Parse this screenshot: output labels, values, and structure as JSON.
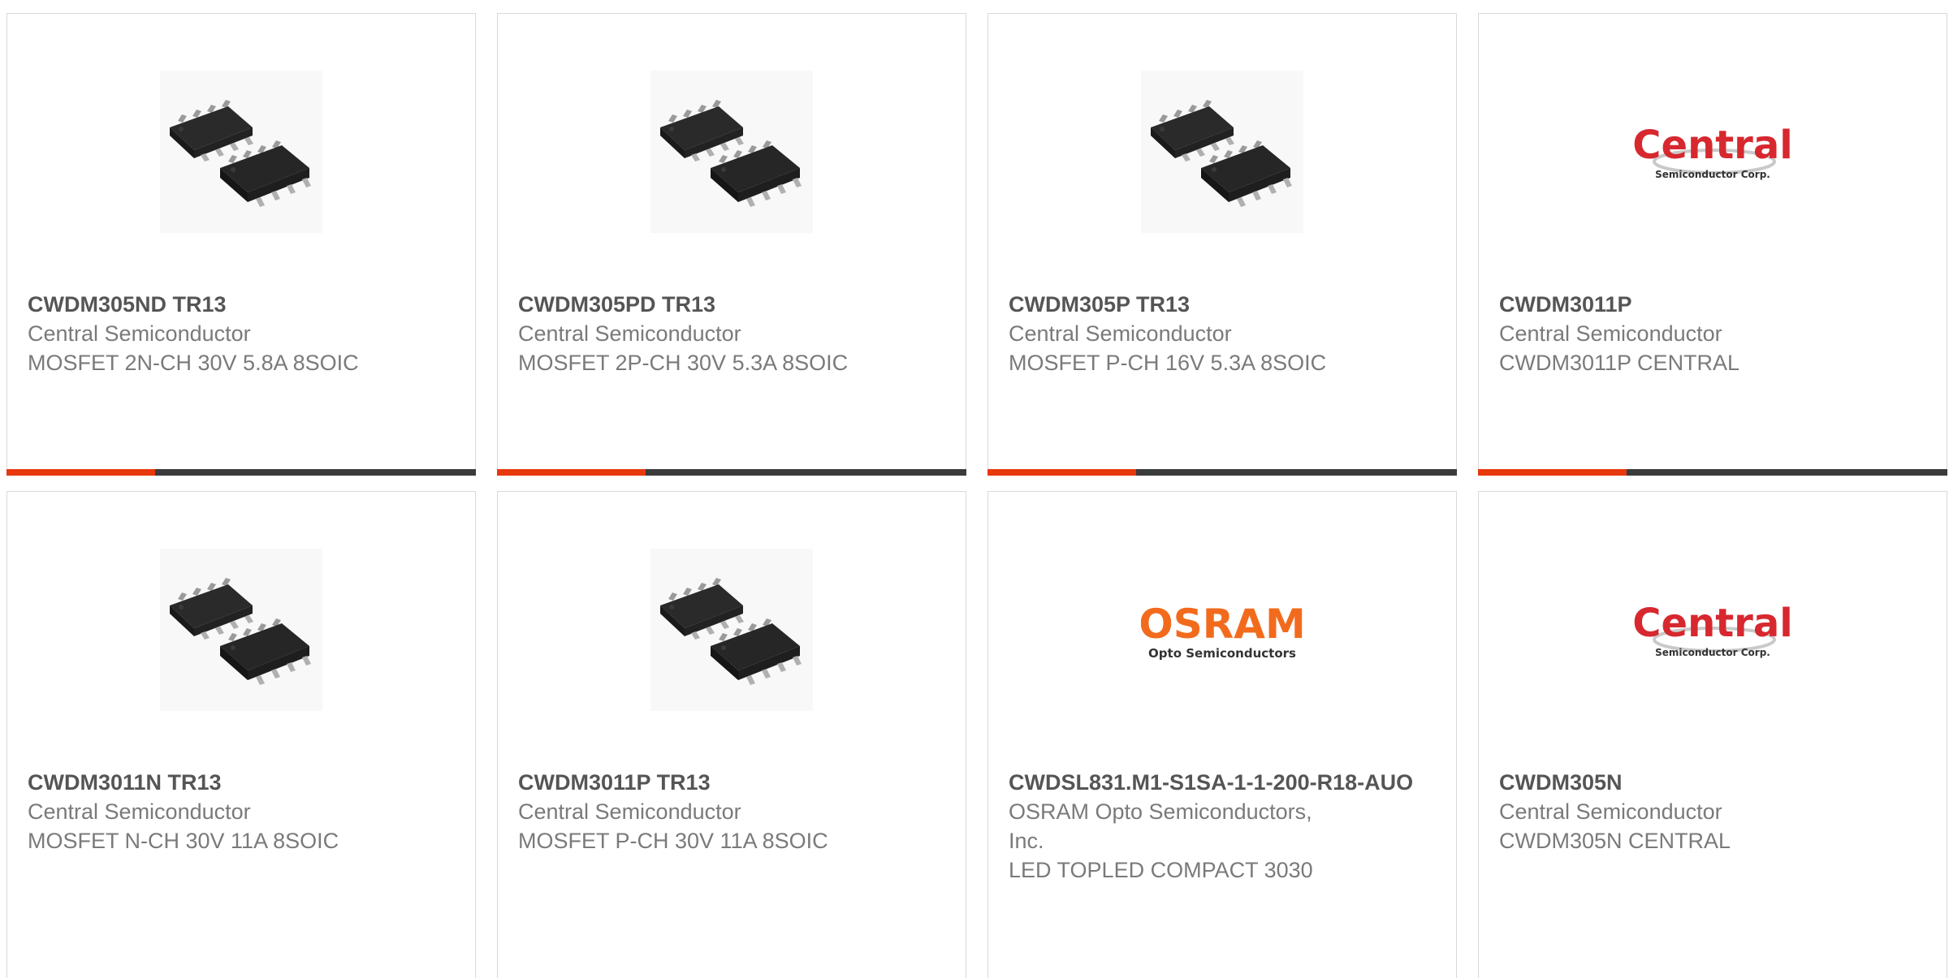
{
  "colors": {
    "accent": "#e8380d",
    "bar_dark": "#3b3b3b",
    "osram_orange": "#f26b1d",
    "central_red": "#d7282f"
  },
  "products": [
    {
      "part_number": "CWDM305ND TR13",
      "manufacturer": "Central Semiconductor",
      "description": "MOSFET 2N-CH 30V 5.8A 8SOIC",
      "image": "soic-8-chip-image"
    },
    {
      "part_number": "CWDM305PD TR13",
      "manufacturer": "Central Semiconductor",
      "description": "MOSFET 2P-CH 30V 5.3A 8SOIC",
      "image": "soic-8-chip-image"
    },
    {
      "part_number": "CWDM305P TR13",
      "manufacturer": "Central Semiconductor",
      "description": "MOSFET P-CH 16V 5.3A 8SOIC",
      "image": "soic-8-chip-image"
    },
    {
      "part_number": "CWDM3011P",
      "manufacturer": "Central Semiconductor",
      "description": "CWDM3011P CENTRAL",
      "image": "central-semiconductor-logo",
      "logo_text": "Central",
      "logo_subtext": "Semiconductor Corp."
    },
    {
      "part_number": "CWDM3011N TR13",
      "manufacturer": "Central Semiconductor",
      "description": "MOSFET N-CH 30V 11A 8SOIC",
      "image": "soic-8-chip-image"
    },
    {
      "part_number": "CWDM3011P TR13",
      "manufacturer": "Central Semiconductor",
      "description": "MOSFET P-CH 30V 11A 8SOIC",
      "image": "soic-8-chip-image"
    },
    {
      "part_number": "CWDSL831.M1-S1SA-1-1-200-R18-AUO",
      "manufacturer": "OSRAM Opto Semiconductors, Inc.",
      "description": "LED TOPLED COMPACT 3030",
      "image": "osram-logo",
      "logo_text": "OSRAM",
      "logo_subtext": "Opto Semiconductors"
    },
    {
      "part_number": "CWDM305N",
      "manufacturer": "Central Semiconductor",
      "description": "CWDM305N CENTRAL",
      "image": "central-semiconductor-logo",
      "logo_text": "Central",
      "logo_subtext": "Semiconductor Corp."
    }
  ]
}
